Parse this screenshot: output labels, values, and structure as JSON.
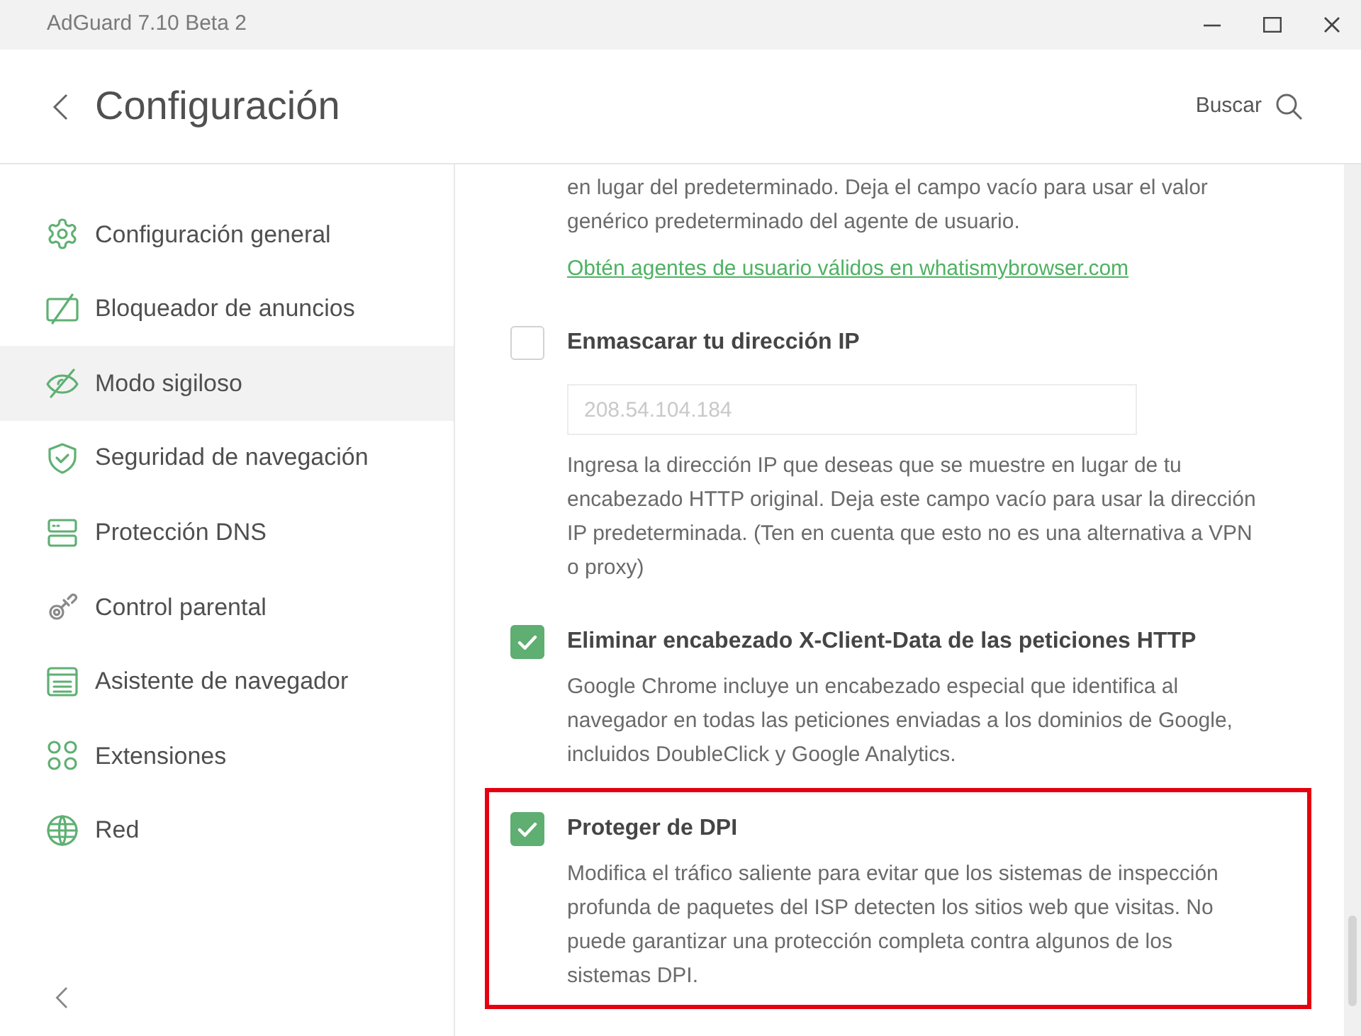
{
  "window": {
    "title": "AdGuard 7.10 Beta 2"
  },
  "header": {
    "title": "Configuración",
    "search_label": "Buscar"
  },
  "sidebar": {
    "items": [
      {
        "label": "Configuración general",
        "selected": false
      },
      {
        "label": "Bloqueador de anuncios",
        "selected": false
      },
      {
        "label": "Modo sigiloso",
        "selected": true
      },
      {
        "label": "Seguridad de navegación",
        "selected": false
      },
      {
        "label": "Protección DNS",
        "selected": false
      },
      {
        "label": "Control parental",
        "selected": false
      },
      {
        "label": "Asistente de navegador",
        "selected": false
      },
      {
        "label": "Extensiones",
        "selected": false
      },
      {
        "label": "Red",
        "selected": false
      }
    ]
  },
  "settings": [
    {
      "kind": "text",
      "highlighted": false,
      "description": "en lugar del predeterminado. Deja el campo vacío para usar el valor genérico predeterminado del agente de usuario.",
      "link": "Obtén agentes de usuario válidos en whatismybrowser.com"
    },
    {
      "kind": "checkbox",
      "highlighted": false,
      "title": "Enmascarar tu dirección IP",
      "checked": false,
      "input": {
        "placeholder": "208.54.104.184"
      },
      "description": "Ingresa la dirección IP que deseas que se muestre en lugar de tu encabezado HTTP original. Deja este campo vacío para usar la dirección IP predeterminada. (Ten en cuenta que esto no es una alternativa a VPN o proxy)"
    },
    {
      "kind": "checkbox",
      "highlighted": false,
      "title": "Eliminar encabezado X-Client-Data de las peticiones HTTP",
      "checked": true,
      "description": "Google Chrome incluye un encabezado especial que identifica al navegador en todas las peticiones enviadas a los dominios de Google, incluidos DoubleClick y Google Analytics."
    },
    {
      "kind": "checkbox",
      "highlighted": true,
      "title": "Proteger de DPI",
      "checked": true,
      "description": "Modifica el tráfico saliente para evitar que los sistemas de inspección profunda de paquetes del ISP detecten los sitios web que visitas. No puede garantizar una protección completa contra algunos de los sistemas DPI."
    }
  ]
}
